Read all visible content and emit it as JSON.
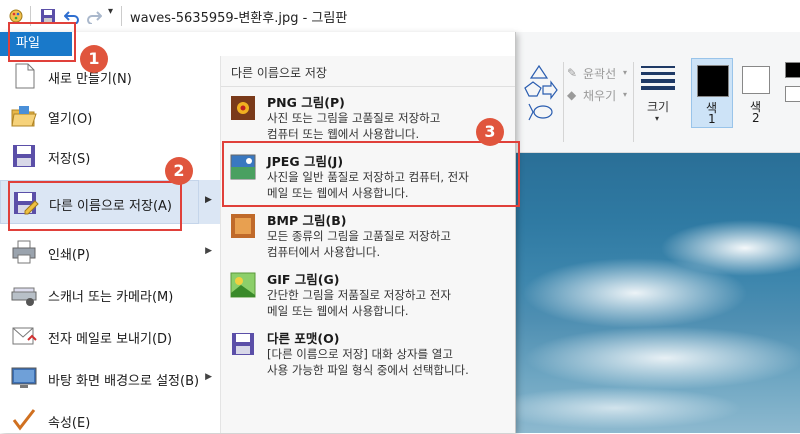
{
  "window": {
    "title": "waves-5635959-변환후.jpg - 그림판"
  },
  "menu": {
    "file_tab": "파일",
    "items": [
      {
        "label": "새로 만들기(N)",
        "icon": "new-file-icon",
        "arrow": ""
      },
      {
        "label": "열기(O)",
        "icon": "open-folder-icon",
        "arrow": ""
      },
      {
        "label": "저장(S)",
        "icon": "save-disk-icon",
        "arrow": ""
      },
      {
        "label": "다른 이름으로 저장(A)",
        "icon": "save-as-icon",
        "arrow": "▶"
      },
      {
        "label": "인쇄(P)",
        "icon": "printer-icon",
        "arrow": "▶"
      },
      {
        "label": "스캐너 또는 카메라(M)",
        "icon": "scanner-icon",
        "arrow": ""
      },
      {
        "label": "전자 메일로 보내기(D)",
        "icon": "email-icon",
        "arrow": ""
      },
      {
        "label": "바탕 화면 배경으로 설정(B)",
        "icon": "desktop-background-icon",
        "arrow": "▶"
      },
      {
        "label": "속성(E)",
        "icon": "properties-icon",
        "arrow": ""
      }
    ]
  },
  "submenu": {
    "header": "다른 이름으로 저장",
    "items": [
      {
        "title": "PNG 그림(P)",
        "desc1": "사진 또는 그림을 고품질로 저장하고",
        "desc2": "컴퓨터 또는 웹에서 사용합니다.",
        "icon": "png-picture-icon"
      },
      {
        "title": "JPEG 그림(J)",
        "desc1": "사진을 일반 품질로 저장하고 컴퓨터, 전자",
        "desc2": "메일 또는 웹에서 사용합니다.",
        "icon": "jpeg-picture-icon"
      },
      {
        "title": "BMP 그림(B)",
        "desc1": "모든 종류의 그림을 고품질로 저장하고",
        "desc2": "컴퓨터에서 사용합니다.",
        "icon": "bmp-picture-icon"
      },
      {
        "title": "GIF 그림(G)",
        "desc1": "간단한 그림을 저품질로 저장하고 전자",
        "desc2": "메일 또는 웹에서 사용합니다.",
        "icon": "gif-picture-icon"
      },
      {
        "title": "다른 포맷(O)",
        "desc1": "[다른 이름으로 저장] 대화 상자를 열고",
        "desc2": "사용 가능한 파일 형식 중에서 선택합니다.",
        "icon": "other-format-icon"
      }
    ]
  },
  "ribbon": {
    "outline": "윤곽선",
    "fill": "채우기",
    "size": "크기",
    "color1_a": "색",
    "color1_b": "1",
    "color2_a": "색",
    "color2_b": "2"
  },
  "annotations": {
    "step1": "1",
    "step2": "2",
    "step3": "3"
  },
  "colors": {
    "accent": "#1979ca",
    "annotation_red": "#e0403a",
    "highlight": "#dbe6f4"
  }
}
